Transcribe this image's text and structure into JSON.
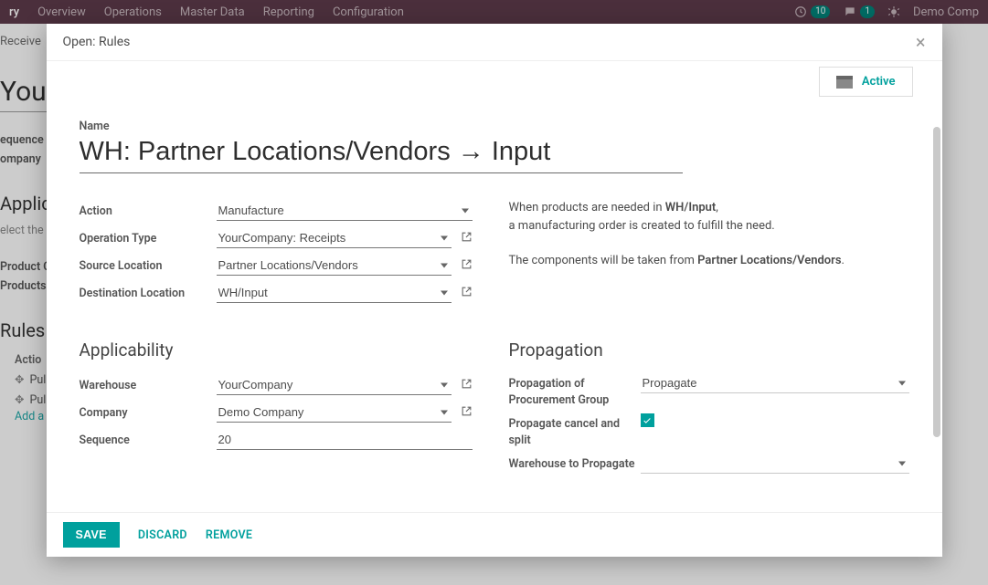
{
  "topbar": {
    "brand": "ry",
    "menu": [
      "Overview",
      "Operations",
      "Master Data",
      "Reporting",
      "Configuration"
    ],
    "activity_count": "10",
    "chat_count": "1",
    "company": "Demo Comp"
  },
  "background": {
    "breadcrumb": "Receive",
    "title": "You",
    "row_sequence_label": "equence",
    "row_company_label": "ompany",
    "section_applicability": "Applic",
    "sub_text": "elect the",
    "product_c_label": "Product C",
    "products_label": "Products",
    "rules_title": "Rules",
    "rules_action_label": "Actio",
    "rule_item": "Pull &",
    "add_line": "Add a"
  },
  "modal": {
    "title": "Open: Rules",
    "status_label": "Active",
    "name_label": "Name",
    "name_value": "WH: Partner Locations/Vendors → Input",
    "fields": {
      "action_label": "Action",
      "action_value": "Manufacture",
      "operation_type_label": "Operation Type",
      "operation_type_value": "YourCompany: Receipts",
      "source_location_label": "Source Location",
      "source_location_value": "Partner Locations/Vendors",
      "destination_location_label": "Destination Location",
      "destination_location_value": "WH/Input"
    },
    "info": {
      "line1_pre": "When products are needed in ",
      "line1_bold": "WH/Input",
      "line1_post": ",",
      "line2": "a manufacturing order is created to fulfill the need.",
      "line3_pre": "The components will be taken from ",
      "line3_bold": "Partner Locations/Vendors",
      "line3_post": "."
    },
    "applicability": {
      "title": "Applicability",
      "warehouse_label": "Warehouse",
      "warehouse_value": "YourCompany",
      "company_label": "Company",
      "company_value": "Demo Company",
      "sequence_label": "Sequence",
      "sequence_value": "20"
    },
    "propagation": {
      "title": "Propagation",
      "group_label": "Propagation of Procurement Group",
      "group_value": "Propagate",
      "cancel_label": "Propagate cancel and split",
      "cancel_value": true,
      "warehouse_label": "Warehouse to Propagate",
      "warehouse_value": ""
    },
    "footer": {
      "save": "SAVE",
      "discard": "DISCARD",
      "remove": "REMOVE"
    }
  }
}
